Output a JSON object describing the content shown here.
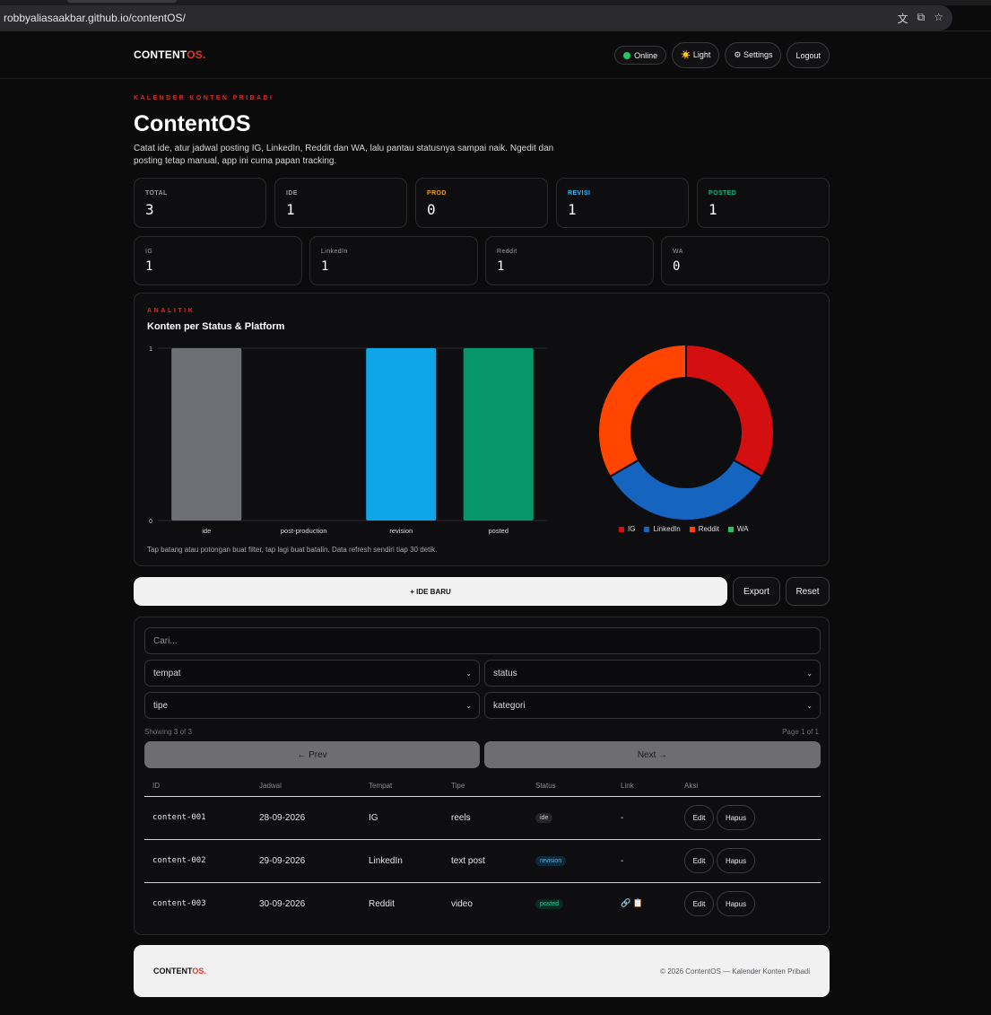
{
  "browser": {
    "url": "robbyaliasaakbar.github.io/contentOS/"
  },
  "header": {
    "logo_main": "CONTENT",
    "logo_accent": "OS.",
    "online_label": "Online",
    "light_label": "☀️ Light",
    "settings_label": "⚙ Settings",
    "logout_label": "Logout"
  },
  "hero": {
    "kicker": "KALENDER KONTEN PRIBADI",
    "title": "ContentOS",
    "description": "Catat ide, atur jadwal posting IG, LinkedIn, Reddit dan WA, lalu pantau statusnya sampai naik. Ngedit dan posting tetap manual, app ini cuma papan tracking."
  },
  "stats_status": [
    {
      "label": "TOTAL",
      "value": "3",
      "color": "#9a9aa0"
    },
    {
      "label": "IDE",
      "value": "1",
      "color": "#9a9aa0"
    },
    {
      "label": "PROD",
      "value": "0",
      "color": "#f59e0b"
    },
    {
      "label": "REVISI",
      "value": "1",
      "color": "#38bdf8"
    },
    {
      "label": "POSTED",
      "value": "1",
      "color": "#10b981"
    }
  ],
  "stats_platform": [
    {
      "label": "IG",
      "value": "1"
    },
    {
      "label": "LinkedIn",
      "value": "1"
    },
    {
      "label": "Reddit",
      "value": "1"
    },
    {
      "label": "WA",
      "value": "0"
    }
  ],
  "analytics": {
    "kicker": "ANALITIK",
    "title": "Konten per Status & Platform",
    "note": "Tap batang atau potongan buat filter, tap lagi buat batalin. Data refresh sendiri tiap 30 detik."
  },
  "chart_data": [
    {
      "type": "bar",
      "categories": [
        "ide",
        "post-production",
        "revision",
        "posted"
      ],
      "values": [
        1,
        0,
        1,
        1
      ],
      "colors": [
        "#6e6e75",
        "#f59e0b",
        "#0ea5e9",
        "#059669"
      ],
      "ylim": [
        0,
        1
      ],
      "yticks": [
        "0",
        "1"
      ],
      "grid": true
    },
    {
      "type": "pie",
      "donut": true,
      "labels": [
        "IG",
        "LinkedIn",
        "Reddit",
        "WA"
      ],
      "values": [
        1,
        1,
        1,
        0
      ],
      "colors": [
        "#d40f0f",
        "#1565c0",
        "#ff4500",
        "#22c55e"
      ],
      "legend": "bottom"
    }
  ],
  "actions": {
    "new_idea": "+ IDE BARU",
    "export": "Export",
    "reset": "Reset"
  },
  "filters": {
    "search_placeholder": "Cari...",
    "tempat": "tempat",
    "status": "status",
    "tipe": "tipe",
    "kategori": "kategori"
  },
  "pagination": {
    "showing": "Showing 3 of 3",
    "page": "Page 1 of 1",
    "prev": "← Prev",
    "next": "Next →"
  },
  "table": {
    "headers": [
      "ID",
      "Jadwal",
      "Tempat",
      "Tipe",
      "Status",
      "Link",
      "Aksi"
    ],
    "rows": [
      {
        "id": "content-001",
        "jadwal": "28-09-2026",
        "tempat": "IG",
        "tipe": "reels",
        "status": "ide",
        "link": "-",
        "edit": "Edit",
        "hapus": "Hapus"
      },
      {
        "id": "content-002",
        "jadwal": "29-09-2026",
        "tempat": "LinkedIn",
        "tipe": "text post",
        "status": "revision",
        "link": "-",
        "edit": "Edit",
        "hapus": "Hapus"
      },
      {
        "id": "content-003",
        "jadwal": "30-09-2026",
        "tempat": "Reddit",
        "tipe": "video",
        "status": "posted",
        "link": "🔗 📋",
        "edit": "Edit",
        "hapus": "Hapus"
      }
    ]
  },
  "footer": {
    "logo_main": "CONTENT",
    "logo_accent": "OS.",
    "copyright": "© 2026 ContentOS — Kalender Konten Pribadi"
  }
}
